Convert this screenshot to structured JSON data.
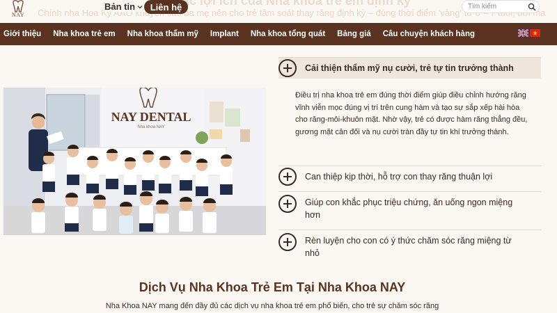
{
  "header": {
    "logo_text": "NAY",
    "ghost_heading": "...ng các lợi ích của Nha khoa trẻ em định kỳ",
    "ghost_text": "Chính nha Hoa Kỳ AAO khuyến cáo ba mẹ nên cho trẻ tầm soát thay răng định kỳ – đúng thời điểm 'vàng' từ 6 – 7 tuổi, bởi mang lại nhiều lợ",
    "news_label": "Bản tin",
    "contact_label": "Liên hệ",
    "search_placeholder": "Tìm kiếm"
  },
  "nav": {
    "items": [
      "Giới thiệu",
      "Nha khoa trẻ em",
      "Nha khoa thẩm mỹ",
      "Implant",
      "Nha khoa tổng quát",
      "Bảng giá",
      "Câu chuyện khách hàng"
    ],
    "flags": [
      "en-flag-icon",
      "vn-flag-icon"
    ]
  },
  "photo": {
    "sign_text": "NAY DENTAL",
    "sign_subtext": "Nha khoa NAY"
  },
  "accordion": {
    "items": [
      {
        "title": "Cải thiện thẩm mỹ nụ cười, trẻ tự tin trưởng thành",
        "open": true
      },
      {
        "title": "Can thiệp kịp thời, hỗ trợ con thay răng thuận lợi",
        "open": false
      },
      {
        "title": "Giúp con khắc phục triệu chứng, ăn uống ngon miệng hơn",
        "open": false
      },
      {
        "title": "Rèn luyện cho con có ý thức chăm sóc răng miệng từ nhỏ",
        "open": false
      }
    ],
    "open_body": "Điều trị nha khoa trẻ em đúng thời điểm giúp điều chỉnh hướng răng vĩnh viễn mọc đúng vị trí trên cung hàm và tạo sự sắp xếp hài hòa cho răng-môi-khuôn mặt. Nhờ vậy, trẻ có được hàm răng thẳng đều, gương mặt cân đối và nụ cười tràn đầy tự tin khi trưởng thành."
  },
  "section": {
    "title": "Dịch Vụ Nha Khoa Trẻ Em Tại Nha Khoa NAY",
    "description": "Nha Khoa NAY mang đến đầy đủ các dịch vụ nha khoa trẻ em phổ biến, cho trẻ sự chăm sóc răng"
  },
  "colors": {
    "brand_brown": "#5a3320",
    "background": "#fbf7f3",
    "accordion_open_bg": "#efe6de"
  }
}
